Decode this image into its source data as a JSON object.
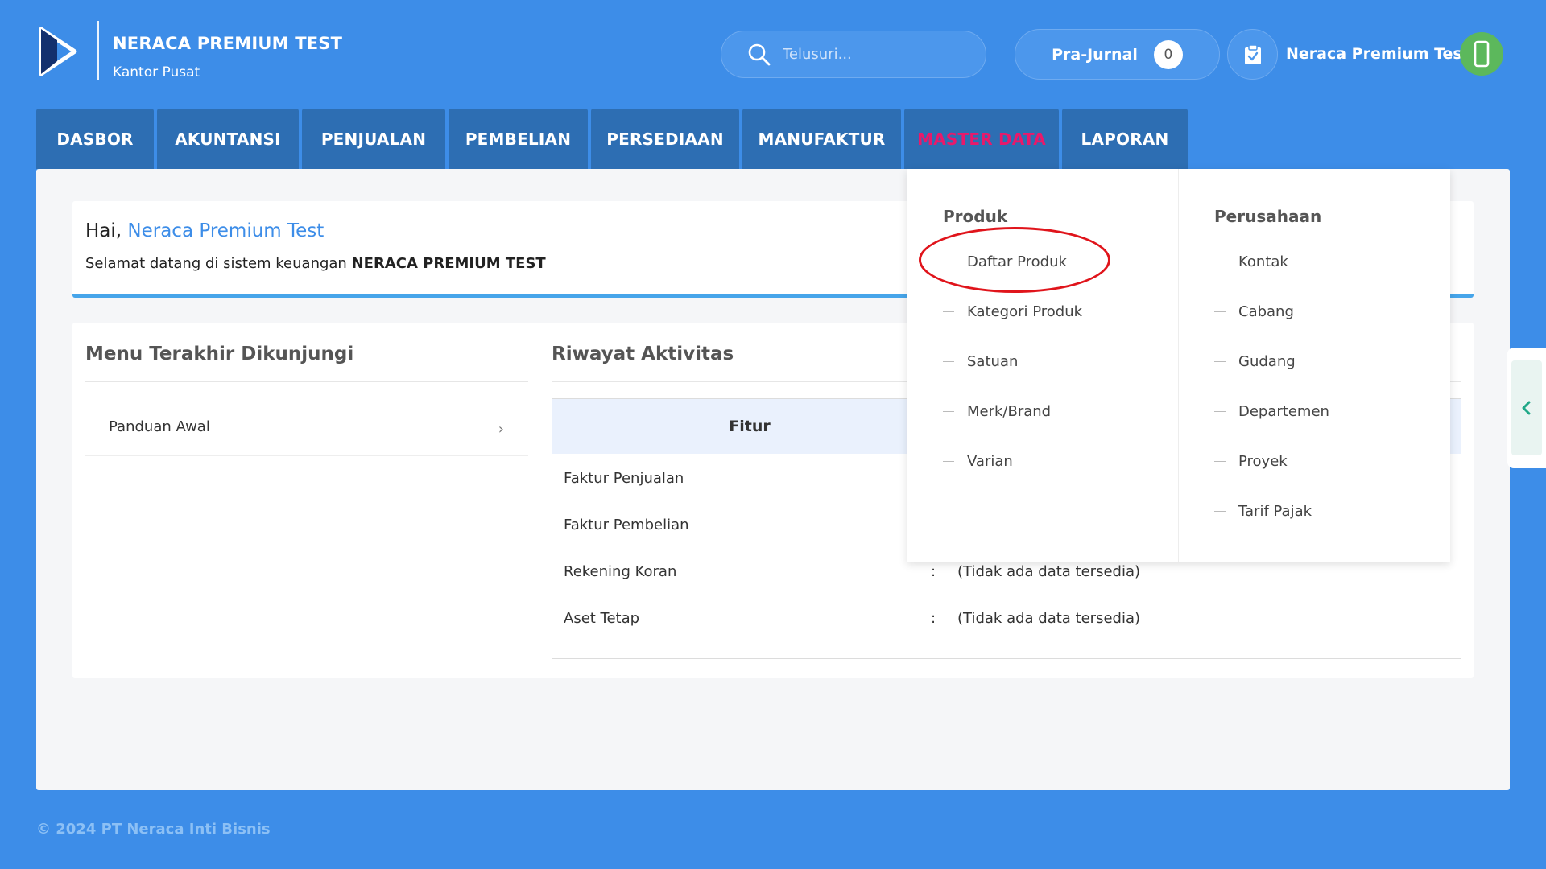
{
  "brand": {
    "title": "NERACA PREMIUM TEST",
    "subtitle": "Kantor Pusat"
  },
  "search": {
    "placeholder": "Telusuri..."
  },
  "prajurnal": {
    "label": "Pra-Jurnal",
    "count": "0"
  },
  "user": {
    "name": "Neraca Premium Test"
  },
  "nav": {
    "tabs": [
      {
        "label": "DASBOR"
      },
      {
        "label": "AKUNTANSI"
      },
      {
        "label": "PENJUALAN"
      },
      {
        "label": "PEMBELIAN"
      },
      {
        "label": "PERSEDIAAN"
      },
      {
        "label": "MANUFAKTUR"
      },
      {
        "label": "MASTER DATA",
        "active": true
      },
      {
        "label": "LAPORAN"
      }
    ]
  },
  "welcome": {
    "greeting": "Hai,",
    "name": "Neraca Premium Test",
    "message": "Selamat datang di sistem keuangan",
    "company": "NERACA PREMIUM TEST"
  },
  "recent": {
    "title": "Menu Terakhir Dikunjungi",
    "items": [
      {
        "label": "Panduan Awal"
      }
    ]
  },
  "activity": {
    "title": "Riwayat Aktivitas",
    "header": "Fitur",
    "rows": [
      {
        "label": "Faktur Penjualan",
        "colon": "",
        "value": ""
      },
      {
        "label": "Faktur Pembelian",
        "colon": "",
        "value": ""
      },
      {
        "label": "Rekening Koran",
        "colon": ":",
        "value": "(Tidak ada data tersedia)"
      },
      {
        "label": "Aset Tetap",
        "colon": ":",
        "value": "(Tidak ada data tersedia)"
      }
    ]
  },
  "dropdown": {
    "produk": {
      "header": "Produk",
      "items": [
        "Daftar Produk",
        "Kategori Produk",
        "Satuan",
        "Merk/Brand",
        "Varian"
      ]
    },
    "perusahaan": {
      "header": "Perusahaan",
      "items": [
        "Kontak",
        "Cabang",
        "Gudang",
        "Departemen",
        "Proyek",
        "Tarif Pajak"
      ]
    }
  },
  "footer": {
    "text": "© 2024 PT Neraca Inti Bisnis"
  },
  "colors": {
    "background": "#3d8de8",
    "tab": "#2d6eb3",
    "active_tab_text": "#e8196b",
    "highlight_circle": "#e0141b",
    "avatar": "#5cb85c"
  }
}
